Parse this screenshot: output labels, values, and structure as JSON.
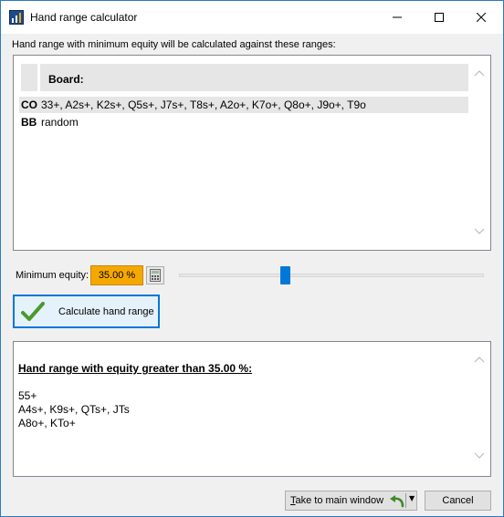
{
  "window": {
    "title": "Hand range calculator",
    "controls": {
      "minimize": "—",
      "maximize": "☐",
      "close": "✕"
    }
  },
  "instructions": "Hand range with minimum equity will be calculated against these ranges:",
  "ranges_panel": {
    "board_label": "Board:",
    "rows": [
      {
        "position": "CO",
        "range": "33+, A2s+, K2s+, Q5s+, J7s+, T8s+, A2o+, K7o+, Q8o+, J9o+, T9o"
      },
      {
        "position": "BB",
        "range": "random"
      }
    ]
  },
  "equity": {
    "label": "Minimum equity:",
    "value": "35.00 %",
    "slider_fraction": 0.35,
    "highlight_color": "#f5a800"
  },
  "calculate_button": {
    "label": "Calculate hand range",
    "icon": "checkmark-icon"
  },
  "result_panel": {
    "title": "Hand range with equity greater than 35.00 %:",
    "lines": [
      "55+",
      "A4s+, K9s+, QTs+, JTs",
      "A8o+, KTo+"
    ]
  },
  "footer": {
    "main_window_button": {
      "accel": "T",
      "rest": "ake to main window",
      "icon": "undo-arrow-icon"
    },
    "cancel_button": "Cancel"
  },
  "accent_color": "#0078d7"
}
